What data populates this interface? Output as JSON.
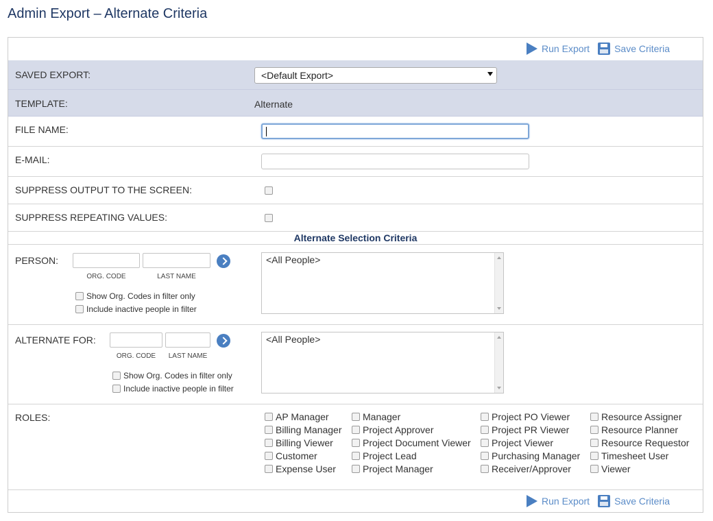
{
  "page": {
    "title": "Admin Export – Alternate Criteria"
  },
  "toolbar": {
    "run_label": "Run Export",
    "save_label": "Save Criteria"
  },
  "saved_export": {
    "label": "SAVED EXPORT:",
    "selected": "<Default Export>"
  },
  "template": {
    "label": "TEMPLATE:",
    "value": "Alternate"
  },
  "file_name": {
    "label": "FILE NAME:",
    "value": ""
  },
  "email": {
    "label": "E-MAIL:",
    "value": ""
  },
  "suppress_output": {
    "label": "SUPPRESS OUTPUT TO THE SCREEN:"
  },
  "suppress_repeating": {
    "label": "SUPPRESS REPEATING VALUES:"
  },
  "section": {
    "title": "Alternate Selection Criteria"
  },
  "person": {
    "label": "PERSON:",
    "org_code_caption": "ORG. CODE",
    "last_name_caption": "LAST NAME",
    "show_org_codes": "Show Org. Codes in filter only",
    "include_inactive": "Include inactive people in filter",
    "list_item": "<All People>"
  },
  "alternate_for": {
    "label": "ALTERNATE FOR:",
    "org_code_caption": "ORG. CODE",
    "last_name_caption": "LAST NAME",
    "show_org_codes": "Show Org. Codes in filter only",
    "include_inactive": "Include inactive people in filter",
    "list_item": "<All People>"
  },
  "roles": {
    "label": "ROLES:",
    "col1": [
      "AP Manager",
      "Billing Manager",
      "Billing Viewer",
      "Customer",
      "Expense User"
    ],
    "col2": [
      "Manager",
      "Project Approver",
      "Project Document Viewer",
      "Project Lead",
      "Project Manager"
    ],
    "col3": [
      "Project PO Viewer",
      "Project PR Viewer",
      "Project Viewer",
      "Purchasing Manager",
      "Receiver/Approver"
    ],
    "col4": [
      "Resource Assigner",
      "Resource Planner",
      "Resource Requestor",
      "Timesheet User",
      "Viewer"
    ]
  },
  "colors": {
    "accent": "#4a7fc1",
    "title": "#1f3864",
    "shaded_row": "#d6dbe9"
  }
}
